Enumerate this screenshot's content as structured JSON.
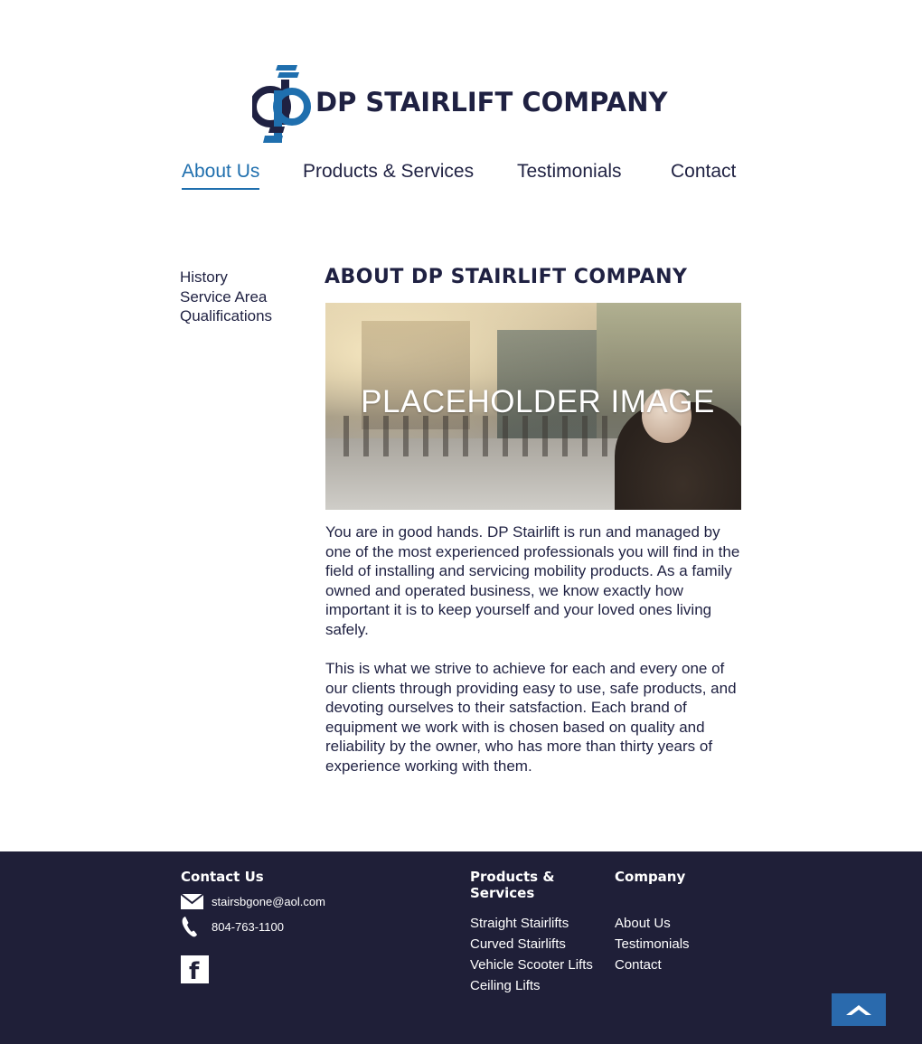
{
  "brand": {
    "name": "DP STAIRLIFT COMPANY",
    "accent": "#1f6fae",
    "dark": "#1f2142"
  },
  "nav": {
    "items": [
      {
        "label": "About Us",
        "active": true
      },
      {
        "label": "Products & Services"
      },
      {
        "label": "Testimonials"
      },
      {
        "label": "Contact"
      }
    ]
  },
  "sidenav": {
    "items": [
      "History",
      "Service Area",
      "Qualifications"
    ]
  },
  "main": {
    "title": "ABOUT DP STAIRLIFT COMPANY",
    "hero_label": "PLACEHOLDER IMAGE",
    "paragraphs": [
      "You are in good hands. DP Stairlift is run and managed by one of the most experienced professionals you will find in the field of installing and servicing mobility products. As a family owned and operated business, we know exactly how important it is to keep yourself and your loved ones living safely.",
      "This is what we strive to achieve for each and every one of our clients through providing easy to use, safe products, and devoting ourselves to their satsfaction. Each brand of equipment we work with is chosen based on quality and reliability by the owner, who has more than thirty years of experience working with them."
    ]
  },
  "footer": {
    "background": "#1f1f38",
    "contact": {
      "heading": "Contact Us",
      "email": "stairsbgone@aol.com",
      "phone": "804-763-1100",
      "social_icon": "facebook-icon"
    },
    "products": {
      "heading": "Products & Services",
      "items": [
        "Straight Stairlifts",
        "Curved Stairlifts",
        "Vehicle Scooter Lifts",
        "Ceiling Lifts"
      ]
    },
    "company": {
      "heading": "Company",
      "items": [
        "About Us",
        "Testimonials",
        "Contact"
      ]
    },
    "back_to_top_icon": "chevron-up-icon"
  }
}
